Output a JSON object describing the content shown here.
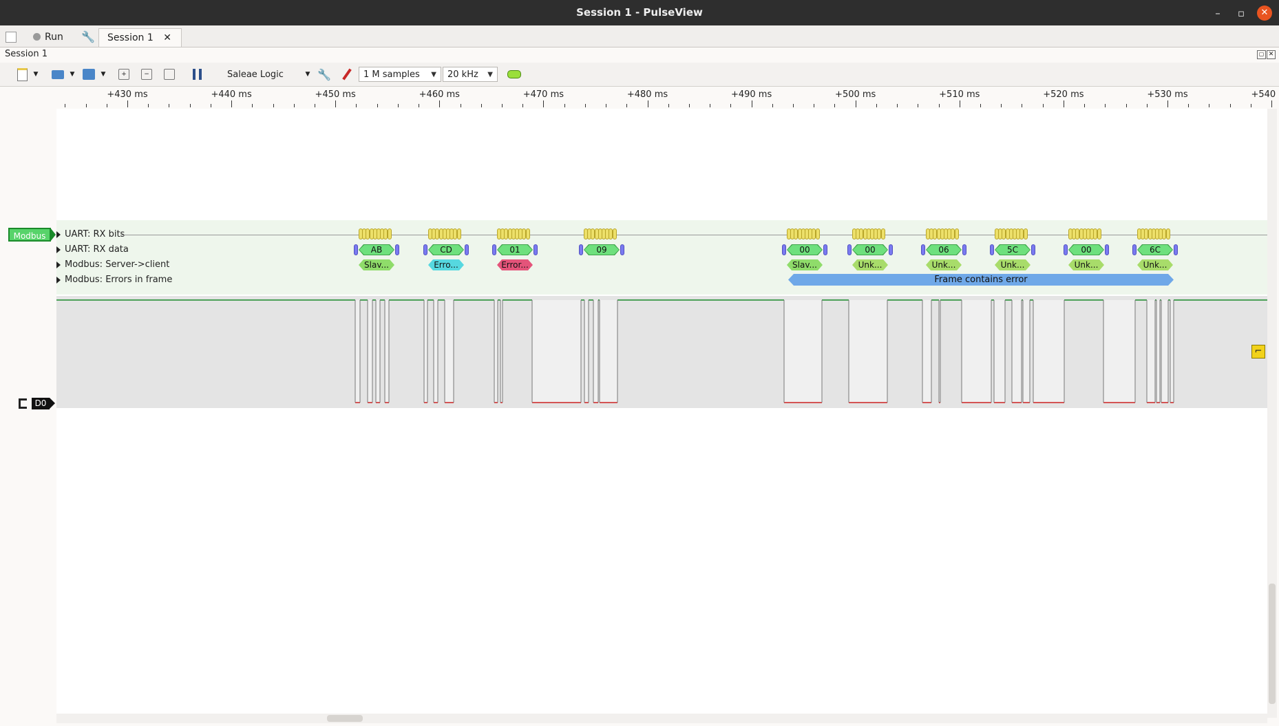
{
  "window": {
    "title": "Session 1 - PulseView"
  },
  "tabs": {
    "run_label": "Run",
    "session_tab": "Session 1"
  },
  "session": {
    "label": "Session 1"
  },
  "toolbar": {
    "device": "Saleae Logic",
    "samples": "1 M samples",
    "rate": "20 kHz"
  },
  "ruler": {
    "ticks": [
      "+430 ms",
      "+440 ms",
      "+450 ms",
      "+460 ms",
      "+470 ms",
      "+480 ms",
      "+490 ms",
      "+500 ms",
      "+510 ms",
      "+520 ms",
      "+530 ms",
      "+540 ms"
    ]
  },
  "decoder": {
    "name": "Modbus",
    "rows": [
      "UART: RX bits",
      "UART: RX data",
      "Modbus: Server->client",
      "Modbus: Errors in frame"
    ],
    "rx_data": [
      "AB",
      "CD",
      "01",
      "09",
      "00",
      "00",
      "06",
      "5C",
      "00",
      "6C"
    ],
    "server_client": [
      "Slav...",
      "Erro...",
      "Error...",
      "Slav...",
      "Unk...",
      "Unk...",
      "Unk...",
      "Unk...",
      "Unk..."
    ],
    "frame_error": "Frame contains error"
  },
  "channel": {
    "name": "D0"
  },
  "colors": {
    "logic_high": "#1a8a2a",
    "logic_low": "#cc2222",
    "decoder_tag": "#57d36a",
    "error_annotation": "#e4547a",
    "warning_annotation": "#56d8e0",
    "frame_annotation": "#6fa8e8"
  }
}
